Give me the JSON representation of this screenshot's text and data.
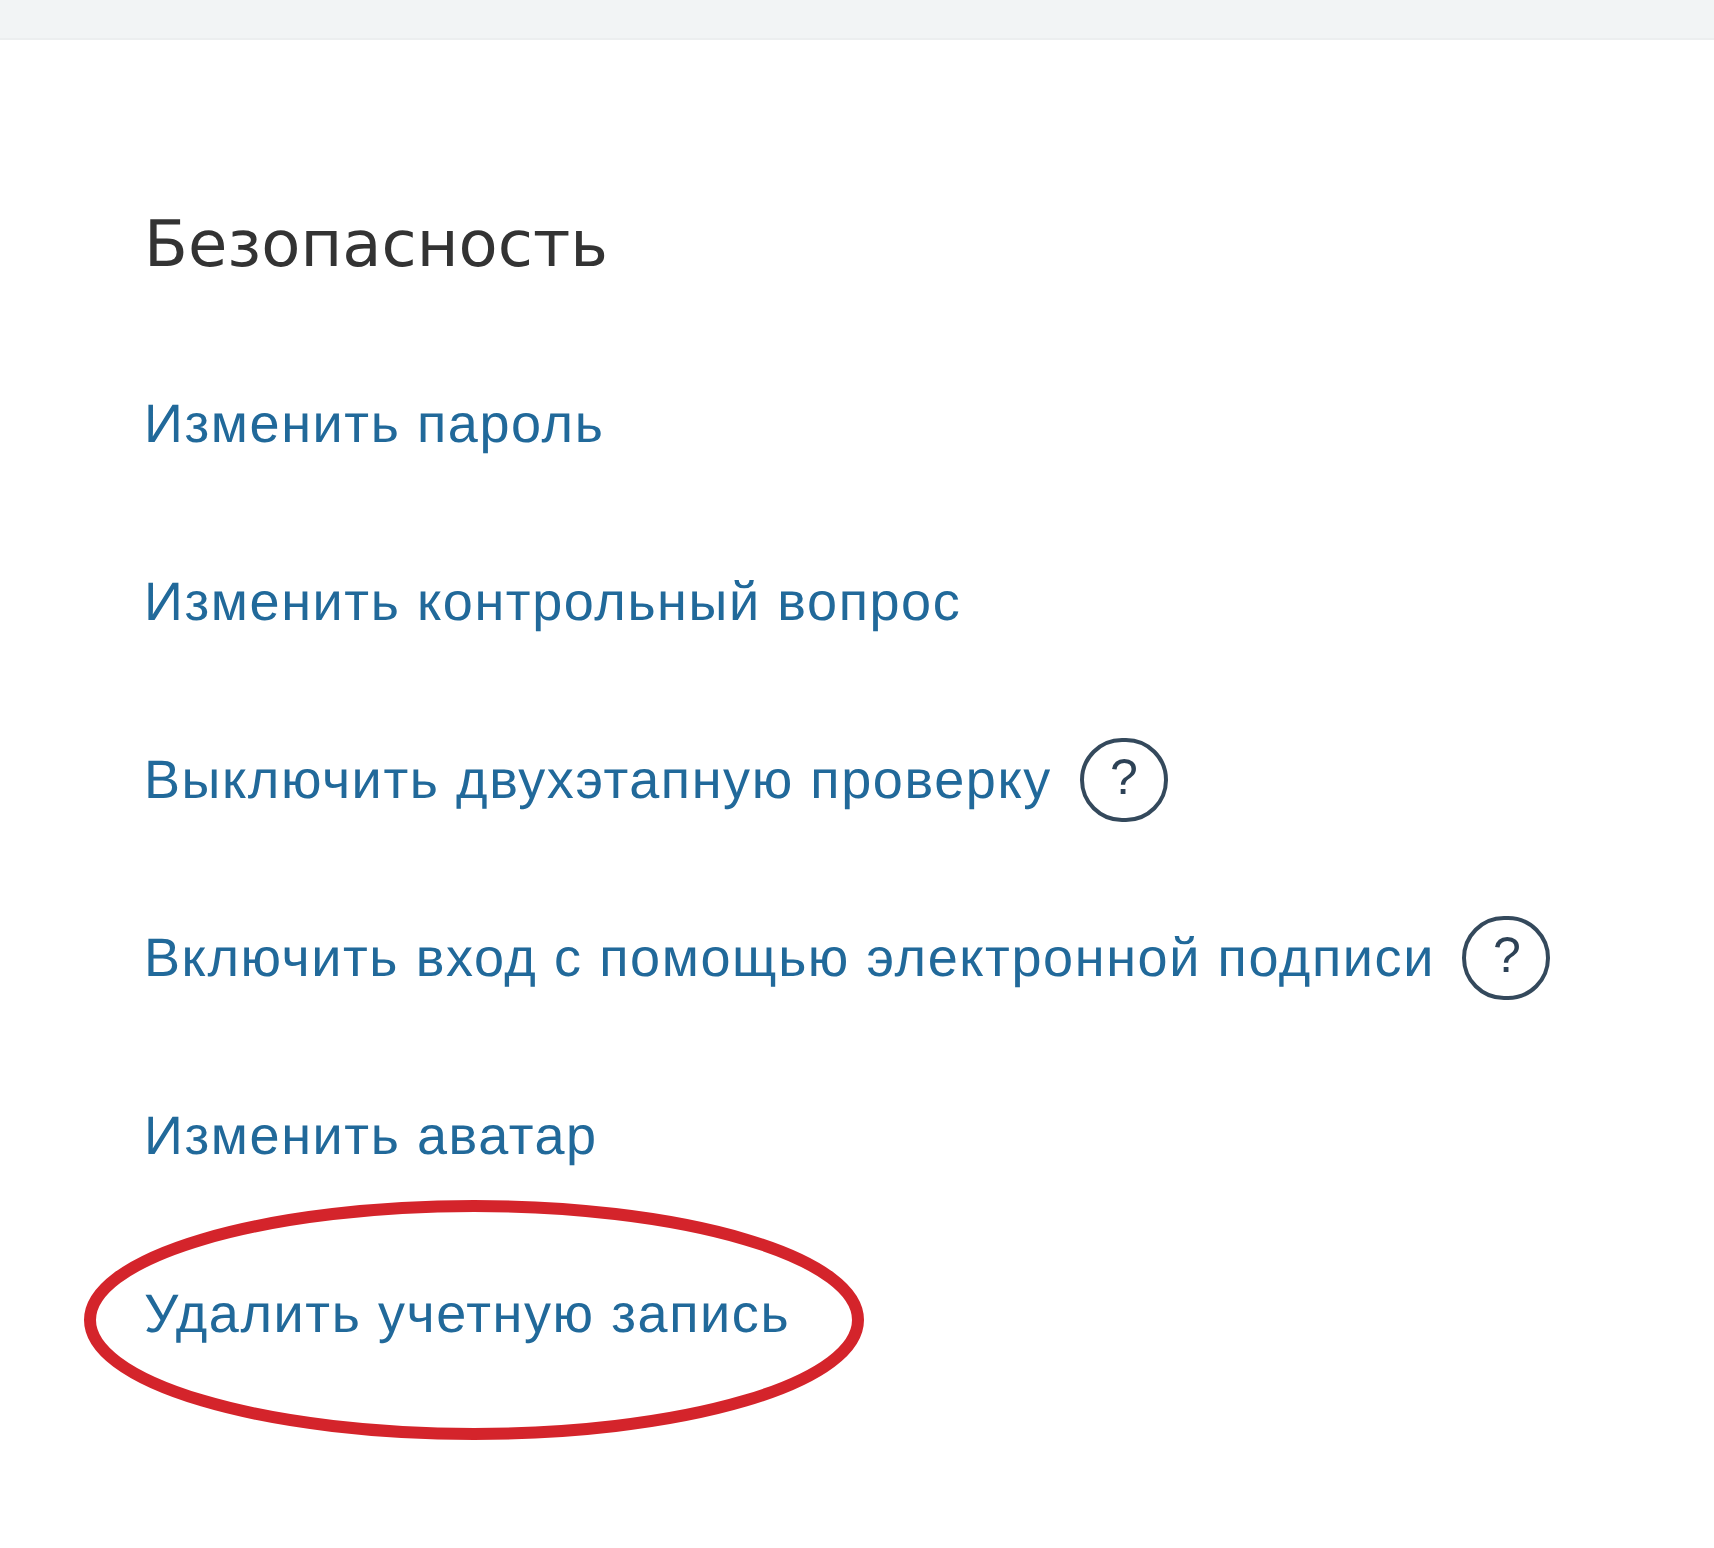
{
  "section": {
    "title": "Безопасность"
  },
  "items": [
    {
      "label": "Изменить пароль",
      "circled": false
    },
    {
      "label": "Изменить контрольный вопрос",
      "circled": false
    },
    {
      "label": "Выключить двухэтапную проверку",
      "help": "?",
      "circled": false
    },
    {
      "label": "Включить вход с помощью электронной подписи",
      "help": "?",
      "circled": false
    },
    {
      "label": "Изменить аватар",
      "circled": false
    },
    {
      "label": "Удалить учетную запись",
      "circled": true
    }
  ]
}
